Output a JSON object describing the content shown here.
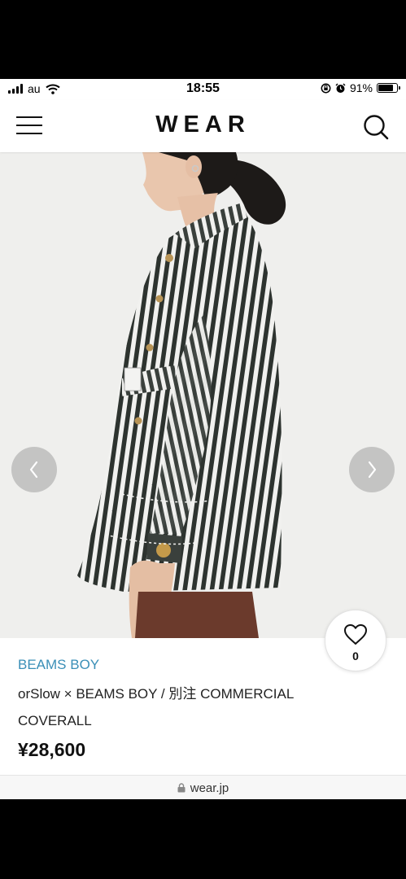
{
  "status_bar": {
    "carrier": "au",
    "time": "18:55",
    "battery": "91%",
    "battery_level": 0.91,
    "icons": [
      "signal-icon",
      "wifi-icon",
      "orientation-lock-icon",
      "alarm-icon",
      "battery-icon"
    ]
  },
  "header": {
    "logo": "WEAR",
    "icons": [
      "hamburger-menu-icon",
      "search-icon"
    ]
  },
  "carousel": {
    "icons": [
      "chevron-left-icon",
      "chevron-right-icon"
    ]
  },
  "like": {
    "count": "0",
    "icon": "heart-outline-icon"
  },
  "product": {
    "brand": "BEAMS BOY",
    "name": "orSlow × BEAMS BOY / 別注 COMMERCIAL COVERALL",
    "price": "¥28,600"
  },
  "url_bar": {
    "url": "wear.jp",
    "icon": "lock-icon"
  },
  "colors": {
    "brand_link": "#3a8fb7",
    "photo_background": "#efefed",
    "stripe_dark": "#2d332f"
  }
}
